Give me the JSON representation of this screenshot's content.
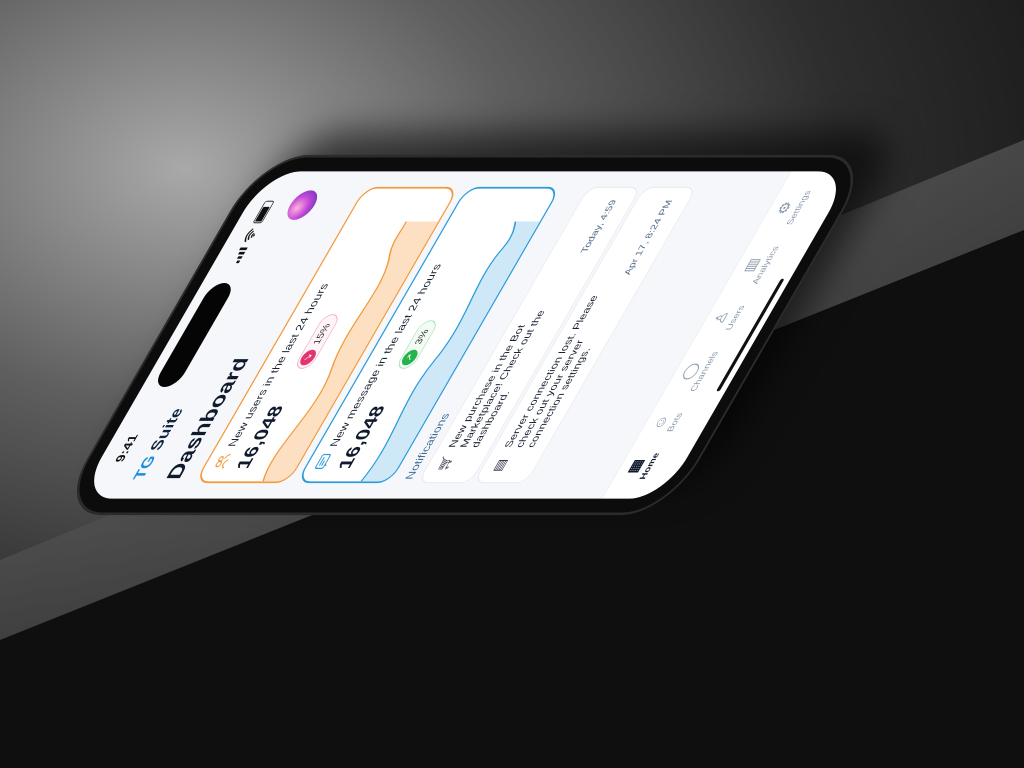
{
  "status": {
    "time": "9:41"
  },
  "app": {
    "logo_tg": "TG",
    "logo_rest": " Suite"
  },
  "page": {
    "title": "Dashboard"
  },
  "cards": [
    {
      "label": "New users in the last 24 hours",
      "value": "16,048",
      "change": "15%",
      "trend": "down",
      "icon": "users-icon",
      "accent": "#f39a3c"
    },
    {
      "label": "New message in the last 24 hours",
      "value": "16,048",
      "change": "3%",
      "trend": "up",
      "icon": "message-icon",
      "accent": "#2b9bdc"
    }
  ],
  "notifications": {
    "title": "Notifications",
    "items": [
      {
        "icon": "cart-icon",
        "text": "New purchase in the Bot Marketplace! Check out the dashboard.",
        "date": "Today, 4:59"
      },
      {
        "icon": "server-icon",
        "text": "Server connection lost. Please check out your server connection settings.",
        "date": "Apr 17, 8:24 PM"
      }
    ]
  },
  "tabs": [
    {
      "label": "Home",
      "icon": "grid-icon",
      "active": true
    },
    {
      "label": "Bots",
      "icon": "bot-icon"
    },
    {
      "label": "Channels",
      "icon": "chat-icon"
    },
    {
      "label": "Users",
      "icon": "user-icon"
    },
    {
      "label": "Analytics",
      "icon": "chart-icon"
    },
    {
      "label": "Settings",
      "icon": "gear-icon"
    }
  ]
}
